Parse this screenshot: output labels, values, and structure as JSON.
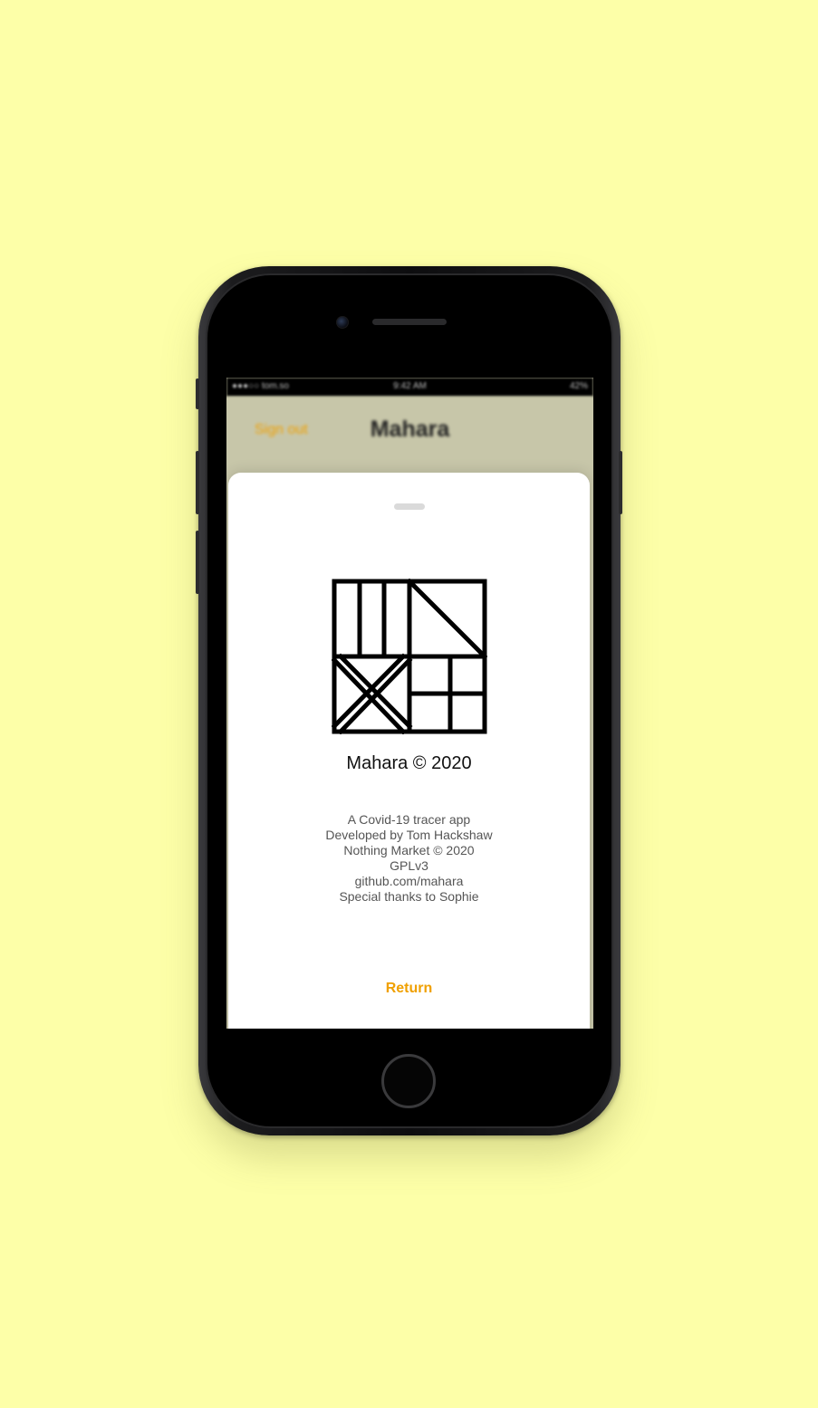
{
  "colors": {
    "background": "#fdffa8",
    "accent": "#f0a000",
    "navbar_bg": "#c7c6a9",
    "sheet_bg": "#ffffff"
  },
  "status_bar": {
    "carrier": "●●●○○ tom.so",
    "time": "9:42 AM",
    "battery": "42%"
  },
  "navbar": {
    "sign_out_label": "Sign out",
    "title": "Mahara"
  },
  "about_sheet": {
    "logo_icon": "mahara-logo-icon",
    "app_title": "Mahara © 2020",
    "info_lines": [
      "A Covid-19 tracer app",
      "Developed by Tom Hackshaw",
      "Nothing Market © 2020",
      "GPLv3",
      "github.com/mahara",
      "Special thanks to Sophie"
    ],
    "return_label": "Return"
  }
}
